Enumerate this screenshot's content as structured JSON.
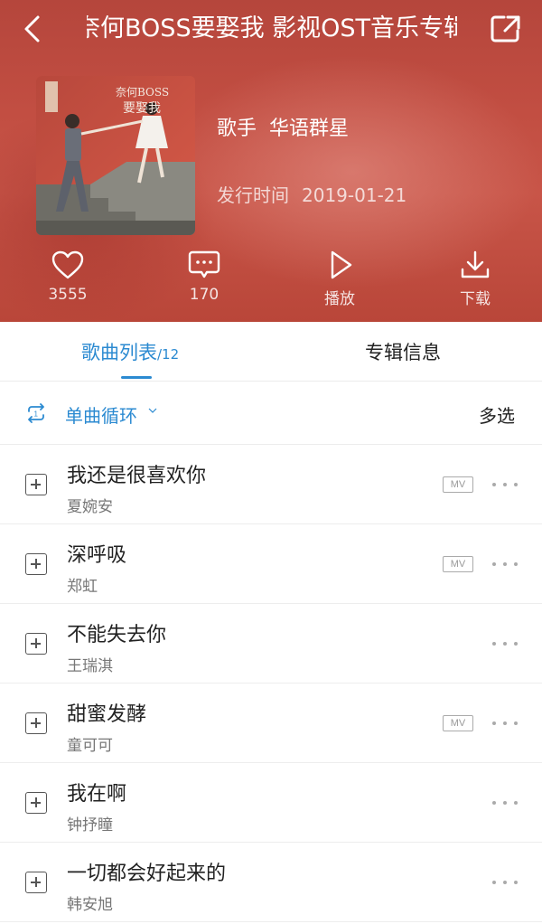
{
  "header": {
    "title": "奈何BOSS要娶我 影视OST音乐专辑",
    "singer_label": "歌手",
    "singer": "华语群星",
    "date_label": "发行时间",
    "release_date": "2019-01-21",
    "actions": [
      {
        "icon": "heart-icon",
        "label": "3555"
      },
      {
        "icon": "comment-icon",
        "label": "170"
      },
      {
        "icon": "play-icon",
        "label": "播放"
      },
      {
        "icon": "download-icon",
        "label": "下载"
      }
    ]
  },
  "tabs": {
    "songs_label": "歌曲列表",
    "songs_count": "/12",
    "info_label": "专辑信息"
  },
  "mode": {
    "icon": "repeat-one-icon",
    "label": "单曲循环",
    "multi_select": "多选"
  },
  "songs": [
    {
      "title": "我还是很喜欢你",
      "artist": "夏婉安",
      "mv": "MV"
    },
    {
      "title": "深呼吸",
      "artist": "郑虹",
      "mv": "MV"
    },
    {
      "title": "不能失去你",
      "artist": "王瑞淇",
      "mv": ""
    },
    {
      "title": "甜蜜发酵",
      "artist": "童可可",
      "mv": "MV"
    },
    {
      "title": "我在啊",
      "artist": "钟抒瞳",
      "mv": ""
    },
    {
      "title": "一切都会好起来的",
      "artist": "韩安旭",
      "mv": ""
    }
  ],
  "colors": {
    "accent": "#2b8ad1",
    "header_bg": "#c24e42"
  }
}
